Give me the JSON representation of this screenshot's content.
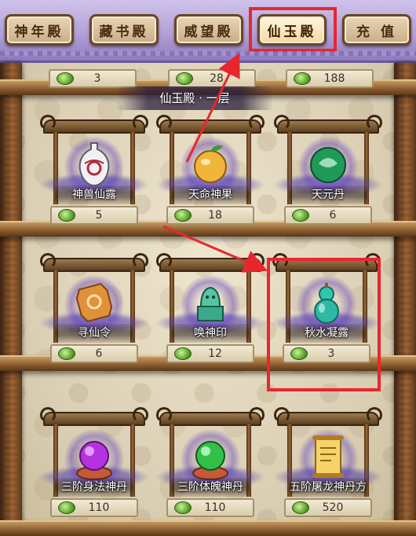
{
  "tabs": [
    {
      "label": "神年殿",
      "active": false
    },
    {
      "label": "藏书殿",
      "active": false
    },
    {
      "label": "威望殿",
      "active": false
    },
    {
      "label": "仙玉殿",
      "active": true
    },
    {
      "label": "充 值",
      "active": false
    }
  ],
  "floor_title": "仙玉殿 · 一层",
  "top_row_prices": [
    "3",
    "28",
    "188"
  ],
  "items": [
    {
      "name": "神兽仙露",
      "price": "5",
      "icon": "porcelain-vase-icon"
    },
    {
      "name": "天命神果",
      "price": "18",
      "icon": "golden-fruit-icon"
    },
    {
      "name": "天元丹",
      "price": "6",
      "icon": "jade-orb-icon"
    },
    {
      "name": "寻仙令",
      "price": "6",
      "icon": "token-plaque-icon"
    },
    {
      "name": "唤神印",
      "price": "12",
      "icon": "jade-seal-icon"
    },
    {
      "name": "秋水凝露",
      "price": "3",
      "icon": "jade-gourd-icon"
    },
    {
      "name": "三阶身法神丹",
      "price": "110",
      "icon": "purple-pill-icon"
    },
    {
      "name": "三阶体魄神丹",
      "price": "110",
      "icon": "green-pill-icon"
    },
    {
      "name": "五阶屠龙神丹方",
      "price": "520",
      "icon": "recipe-scroll-icon"
    }
  ],
  "colors": {
    "highlight": "#e8262e",
    "tab_bar": "#b2a1d8",
    "shelf": "#8d5e30",
    "currency": "#5fa52e"
  },
  "currency_icon": "jade-leaf-coin-icon"
}
